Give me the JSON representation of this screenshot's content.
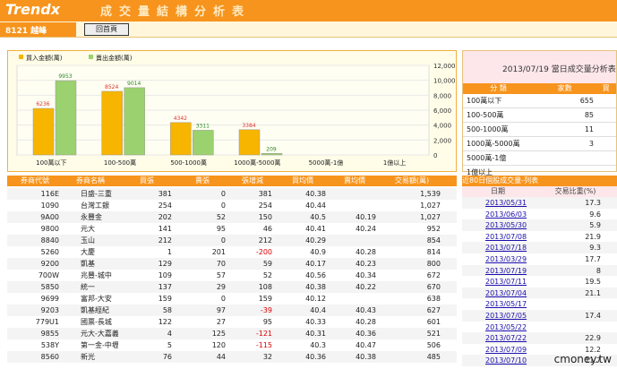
{
  "app": {
    "logo": "Trendx",
    "title": "成交量結構分析表"
  },
  "stock_label": "8121 越峰",
  "back_label": "回首頁",
  "chart_data": {
    "type": "bar",
    "categories": [
      "100萬以下",
      "100-500萬",
      "500-1000萬",
      "1000萬-5000萬",
      "5000萬-1億",
      "1億以上"
    ],
    "series": [
      {
        "name": "買入金額(萬)",
        "values": [
          6236,
          8524,
          4342,
          3384,
          0,
          0
        ],
        "color": "#f7b500"
      },
      {
        "name": "賣出金額(萬)",
        "values": [
          9953,
          9014,
          3311,
          209,
          0,
          0
        ],
        "color": "#9bd16e"
      }
    ],
    "ylim": [
      0,
      12000
    ],
    "yticks": [
      "12,000",
      "10,000",
      "8,000",
      "6,000",
      "4,000",
      "2,000",
      "0"
    ]
  },
  "side": {
    "title": "2013/07/19 當日成交量分析表",
    "col1": "分 類",
    "col2": "家數",
    "col3": "買",
    "rows": [
      [
        "100萬以下",
        "655"
      ],
      [
        "100-500萬",
        "85"
      ],
      [
        "500-1000萬",
        "11"
      ],
      [
        "1000萬-5000萬",
        "3"
      ],
      [
        "5000萬-1億",
        ""
      ],
      [
        "1億以上",
        ""
      ]
    ]
  },
  "table": {
    "headers": [
      "券商代號",
      "券商名稱",
      "買張",
      "賣張",
      "張增減",
      "買均價",
      "賣均價",
      "交易額(萬)"
    ],
    "rows": [
      [
        "116E",
        "日盛-三重",
        "381",
        "0",
        "381",
        "40.38",
        "",
        "1,539"
      ],
      [
        "1090",
        "台灣工銀",
        "254",
        "0",
        "254",
        "40.44",
        "",
        "1,027"
      ],
      [
        "9A00",
        "永豐金",
        "202",
        "52",
        "150",
        "40.5",
        "40.19",
        "1,027"
      ],
      [
        "9800",
        "元大",
        "141",
        "95",
        "46",
        "40.41",
        "40.24",
        "952"
      ],
      [
        "8840",
        "玉山",
        "212",
        "0",
        "212",
        "40.29",
        "",
        "854"
      ],
      [
        "5260",
        "大慶",
        "1",
        "201",
        "-200",
        "40.9",
        "40.28",
        "814"
      ],
      [
        "9200",
        "凱基",
        "129",
        "70",
        "59",
        "40.17",
        "40.23",
        "800"
      ],
      [
        "700W",
        "兆豐-城中",
        "109",
        "57",
        "52",
        "40.56",
        "40.34",
        "672"
      ],
      [
        "5850",
        "統一",
        "137",
        "29",
        "108",
        "40.38",
        "40.22",
        "670"
      ],
      [
        "9699",
        "富邦-大安",
        "159",
        "0",
        "159",
        "40.12",
        "",
        "638"
      ],
      [
        "9203",
        "凱基經紀",
        "58",
        "97",
        "-39",
        "40.4",
        "40.43",
        "627"
      ],
      [
        "779U1",
        "國票-長城",
        "122",
        "27",
        "95",
        "40.33",
        "40.28",
        "601"
      ],
      [
        "9855",
        "元大-大嘉義",
        "4",
        "125",
        "-121",
        "40.31",
        "40.36",
        "521"
      ],
      [
        "538Y",
        "第一金-中壢",
        "5",
        "120",
        "-115",
        "40.3",
        "40.47",
        "506"
      ],
      [
        "8560",
        "新光",
        "76",
        "44",
        "32",
        "40.36",
        "40.38",
        "485"
      ]
    ]
  },
  "right": {
    "caption": "近80日個股成交量-列表",
    "headers": [
      "日期",
      "交易比重(%)"
    ],
    "rows": [
      [
        "2013/05/31",
        "17.3"
      ],
      [
        "2013/06/03",
        "9.6"
      ],
      [
        "2013/05/30",
        "5.9"
      ],
      [
        "2013/07/08",
        "21.9"
      ],
      [
        "2013/07/18",
        "9.3"
      ],
      [
        "2013/03/29",
        "17.7"
      ],
      [
        "2013/07/19",
        "8"
      ],
      [
        "2013/07/11",
        "19.5"
      ],
      [
        "2013/07/04",
        "21.1"
      ],
      [
        "2013/05/17",
        ""
      ],
      [
        "2013/07/05",
        "17.4"
      ],
      [
        "2013/05/22",
        ""
      ],
      [
        "2013/07/22",
        "22.9"
      ],
      [
        "2013/07/09",
        "12.2"
      ],
      [
        "2013/07/10",
        "11.7"
      ]
    ]
  },
  "watermark": "cmoney.tw"
}
